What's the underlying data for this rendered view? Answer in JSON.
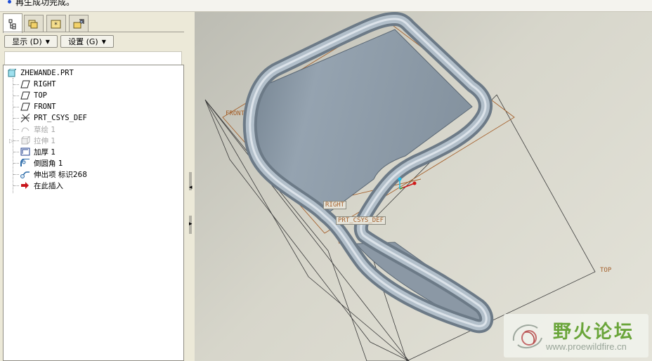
{
  "status": {
    "message": "再生成功完成。",
    "dot_color": "#1f4ed8"
  },
  "left_panel": {
    "tabs": [
      {
        "icon": "model-tree-icon",
        "active": true
      },
      {
        "icon": "folder-browser-icon",
        "active": false
      },
      {
        "icon": "favorites-icon",
        "active": false
      },
      {
        "icon": "connections-icon",
        "active": false
      }
    ],
    "show_button": "显示 (D)",
    "settings_button": "设置 (G)",
    "tree": {
      "root": "ZHEWANDE.PRT",
      "items": [
        {
          "label": "RIGHT",
          "icon": "datum-plane-icon",
          "dim": false
        },
        {
          "label": "TOP",
          "icon": "datum-plane-icon",
          "dim": false
        },
        {
          "label": "FRONT",
          "icon": "datum-plane-icon",
          "dim": false
        },
        {
          "label": "PRT_CSYS_DEF",
          "icon": "coordinate-system-icon",
          "dim": false
        },
        {
          "label": "草绘 1",
          "icon": "sketch-icon",
          "dim": true
        },
        {
          "label": "拉伸 1",
          "icon": "extrude-icon",
          "dim": true
        },
        {
          "label": "加厚 1",
          "icon": "thicken-icon",
          "dim": false
        },
        {
          "label": "倒圆角 1",
          "icon": "round-icon",
          "dim": false
        },
        {
          "label": "伸出项 标识268",
          "icon": "protrusion-icon",
          "dim": false
        },
        {
          "label": "在此插入",
          "icon": "insert-here-icon",
          "dim": false
        }
      ]
    }
  },
  "viewport": {
    "datum_labels": {
      "front": "FRONT",
      "right": "RIGHT",
      "csys": "PRT_CSYS_DEF",
      "top": "TOP"
    },
    "datum_color": "#a5622e",
    "part_color": "#8a97a4"
  },
  "watermark": {
    "title": "野火论坛",
    "url": "www.proewildfire.cn",
    "title_color": "#6aa53a"
  }
}
